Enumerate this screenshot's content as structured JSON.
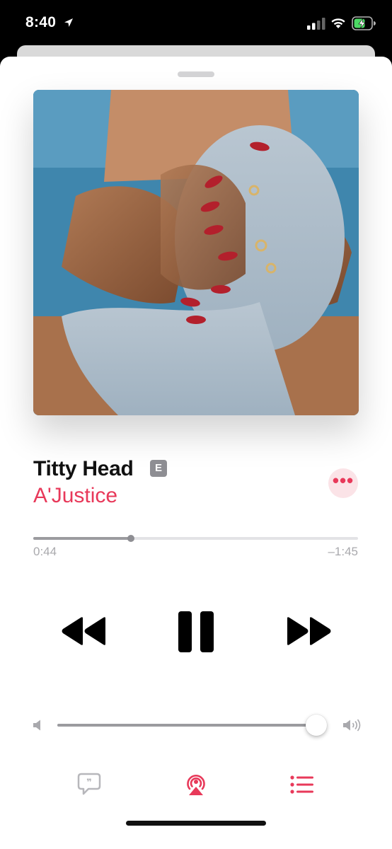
{
  "status_bar": {
    "time": "8:40",
    "icons": [
      "location-arrow-icon",
      "cellular-signal-icon",
      "wifi-icon",
      "battery-charging-icon"
    ]
  },
  "now_playing": {
    "song_title": "Titty Head",
    "explicit_badge": "E",
    "artist": "A'Justice",
    "more_label": "•••",
    "progress": {
      "elapsed": "0:44",
      "remaining": "–1:45",
      "fraction": 0.3
    },
    "volume_fraction": 0.99
  },
  "controls": {
    "icons": [
      "rewind-icon",
      "pause-icon",
      "fast-forward-icon"
    ]
  },
  "toolbar": {
    "icons": [
      "lyrics-icon",
      "airplay-icon",
      "queue-list-icon"
    ]
  },
  "colors": {
    "accent": "#e8395a",
    "accent_soft": "#fbe3e7",
    "secondary_text": "#a9a9ad",
    "track": "#e3e3e6"
  }
}
